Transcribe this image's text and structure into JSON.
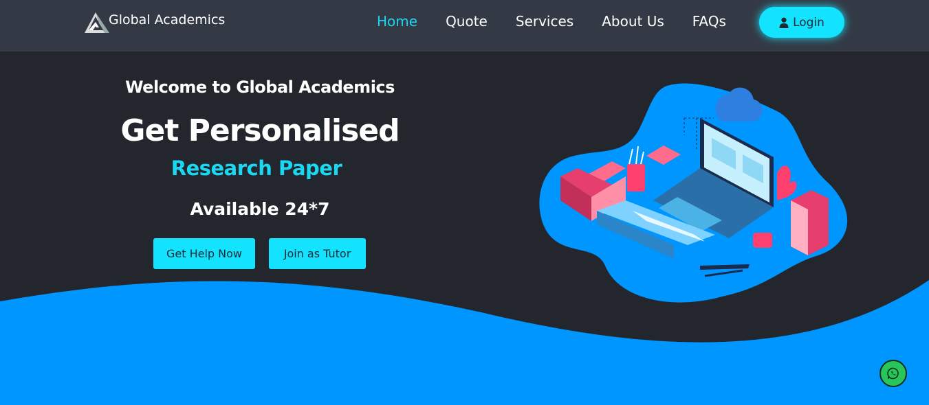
{
  "brand": {
    "name": "Global Academics"
  },
  "nav": {
    "items": [
      {
        "label": "Home",
        "active": true
      },
      {
        "label": "Quote"
      },
      {
        "label": "Services"
      },
      {
        "label": "About Us"
      },
      {
        "label": "FAQs"
      }
    ],
    "login_label": "Login"
  },
  "hero": {
    "welcome": "Welcome to Global Academics",
    "title": "Get Personalised",
    "subtitle": "Research Paper",
    "availability": "Available 24*7",
    "primary_cta": "Get Help Now",
    "secondary_cta": "Join as Tutor"
  },
  "colors": {
    "accent": "#13e3ff",
    "nav_bg": "#343a45",
    "hero_bg": "#23262d",
    "wave": "#0096ff",
    "whatsapp": "#27c65a"
  },
  "icons": [
    "logo-mark-icon",
    "user-icon",
    "whatsapp-icon"
  ]
}
